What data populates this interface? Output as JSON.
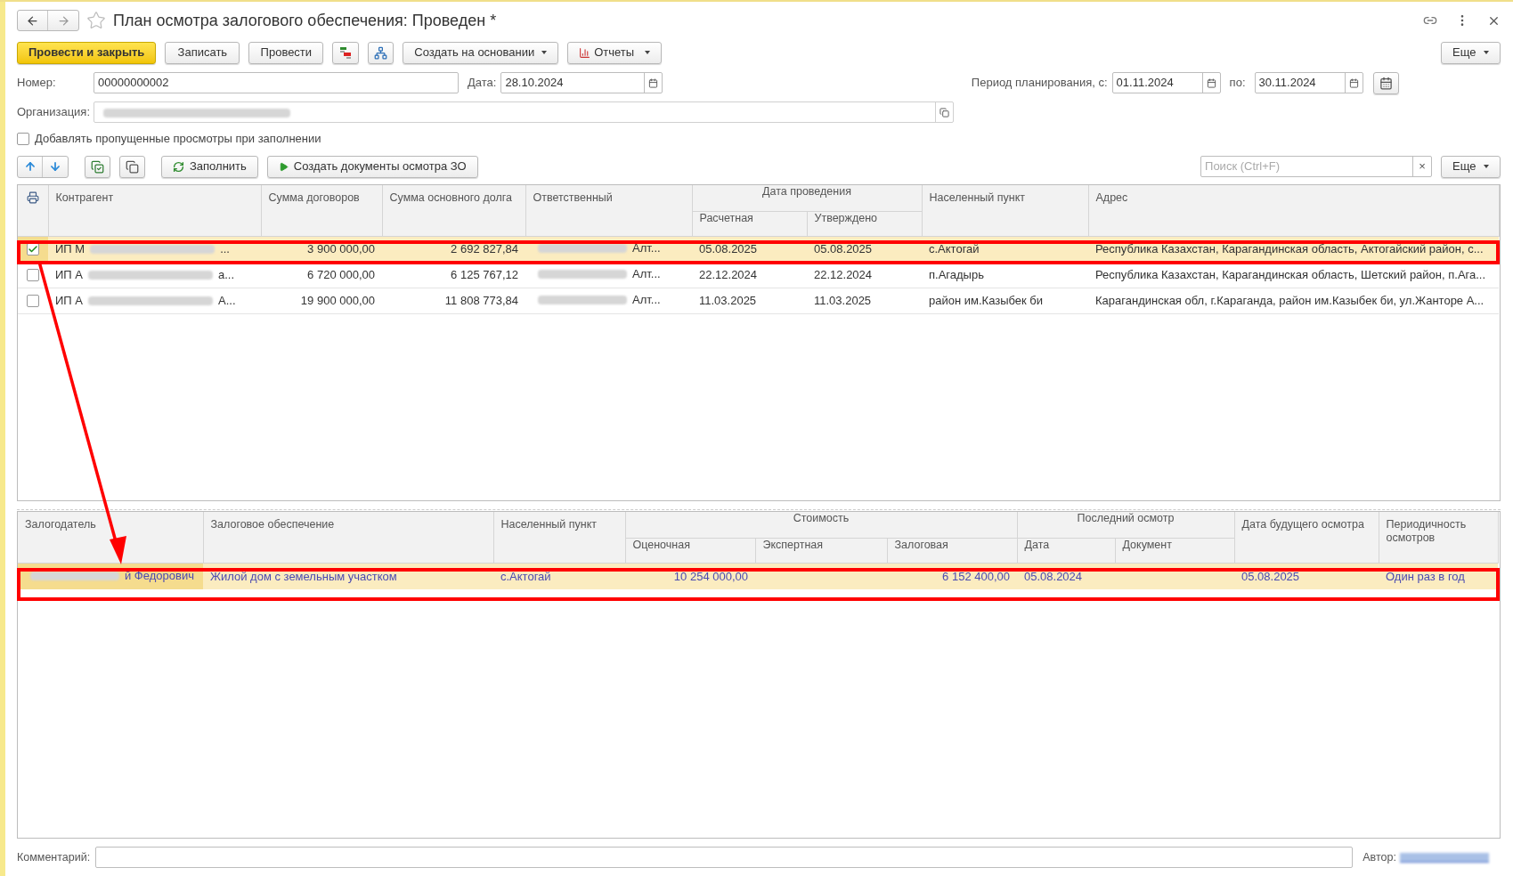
{
  "window": {
    "title": "План осмотра залогового обеспечения: Проведен *"
  },
  "command_bar": [
    {
      "kind": "primary",
      "label": "Провести и закрыть"
    },
    {
      "kind": "plain",
      "label": "Записать"
    },
    {
      "kind": "plain",
      "label": "Провести"
    },
    {
      "kind": "ledger"
    },
    {
      "kind": "structure"
    },
    {
      "kind": "dropdown",
      "label": "Создать на основании"
    },
    {
      "kind": "reports",
      "label": "Отчеты"
    }
  ],
  "more_top": "Еще",
  "number": {
    "label": "Номер:",
    "value": "00000000002"
  },
  "date": {
    "label": "Дата:",
    "value": "28.10.2024"
  },
  "period": {
    "label": "Период планирования, с:",
    "from": "01.11.2024",
    "to_label": "по:",
    "to": "30.11.2024"
  },
  "organization": {
    "label": "Организация:",
    "redacted": true
  },
  "add_missed": {
    "label": "Добавлять пропущенные просмотры при заполнении",
    "checked": false
  },
  "table_toolbar": {
    "fill": "Заполнить",
    "create": "Создать документы осмотра ЗО",
    "search_placeholder": "Поиск (Ctrl+F)",
    "clear": "×",
    "more": "Еще"
  },
  "upper_table": {
    "columns": [
      {
        "label": "Контрагент"
      },
      {
        "label": "Сумма договоров"
      },
      {
        "label": "Сумма основного долга"
      },
      {
        "label": "Ответственный"
      },
      {
        "label": "Дата проведения",
        "colspan": 2,
        "children": [
          {
            "label": "Расчетная"
          },
          {
            "label": "Утверждено"
          }
        ]
      },
      {
        "label": "Населенный пункт"
      },
      {
        "label": "Адрес"
      }
    ],
    "rows": [
      {
        "checked": true,
        "selected": true,
        "cells": [
          {
            "prefix": "ИП М",
            "redacted": true,
            "suffix": " ..."
          },
          "3 900 000,00",
          "2 692 827,84",
          {
            "redacted": true,
            "suffix": "Алт..."
          },
          "05.08.2025",
          "05.08.2025",
          "с.Актогай",
          "Республика Казахстан, Карагандинская область, Актогайский район,  с..."
        ]
      },
      {
        "checked": false,
        "selected": false,
        "cells": [
          {
            "prefix": "ИП А",
            "redacted": true,
            "suffix": "а..."
          },
          "6 720 000,00",
          "6 125 767,12",
          {
            "redacted": true,
            "suffix": "Алт..."
          },
          "22.12.2024",
          "22.12.2024",
          "п.Агадырь",
          "Республика Казахстан, Карагандинская область, Шетский район, п.Ага..."
        ]
      },
      {
        "checked": false,
        "selected": false,
        "cells": [
          {
            "prefix": "ИП А",
            "redacted": true,
            "suffix": "А..."
          },
          "19 900 000,00",
          "11 808 773,84",
          {
            "redacted": true,
            "suffix": "Алт..."
          },
          "11.03.2025",
          "11.03.2025",
          "район им.Казыбек би",
          "Карагандинская обл, г.Караганда, район им.Казыбек би, ул.Жанторе А..."
        ]
      }
    ]
  },
  "lower_table": {
    "columns": [
      {
        "label": "Залогодатель"
      },
      {
        "label": "Залоговое обеспечение"
      },
      {
        "label": "Населенный пункт"
      },
      {
        "label": "Стоимость",
        "colspan": 3,
        "children": [
          {
            "label": "Оценочная"
          },
          {
            "label": "Экспертная"
          },
          {
            "label": "Залоговая"
          }
        ]
      },
      {
        "label": "Последний осмотр",
        "colspan": 2,
        "children": [
          {
            "label": "Дата"
          },
          {
            "label": "Документ"
          }
        ]
      },
      {
        "label": "Дата будущего осмотра"
      },
      {
        "label": "Периодичность осмотров"
      }
    ],
    "rows": [
      {
        "selected": true,
        "cells": [
          {
            "redacted": true,
            "suffix": "й Федорович"
          },
          "Жилой дом с земельным участком",
          "с.Актогай",
          "10 254 000,00",
          "",
          "6 152 400,00",
          "05.08.2024",
          "",
          "05.08.2025",
          "Один раз в год"
        ]
      }
    ]
  },
  "comment": {
    "label": "Комментарий:"
  },
  "author": {
    "label": "Автор:",
    "redacted": true
  }
}
